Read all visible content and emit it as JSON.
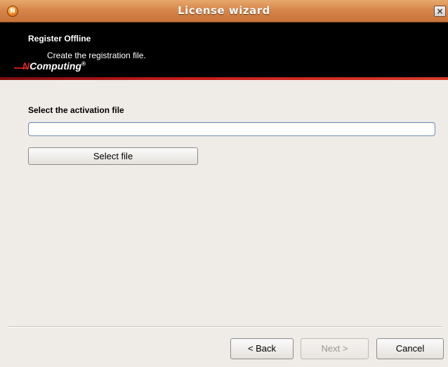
{
  "window": {
    "title": "License wizard",
    "close_glyph": "×",
    "icon": "ncomputing-app-icon",
    "icon_glyph": "N"
  },
  "banner": {
    "title": "Register Offline",
    "subtitle": "Create the registration file.",
    "logo_letter": "N",
    "logo_word": "Computing",
    "logo_mark": "®"
  },
  "form": {
    "label": "Select the activation file",
    "file_path_value": "",
    "file_path_placeholder": "",
    "select_button_label": "Select file"
  },
  "footer": {
    "back_label": "< Back",
    "next_label": "Next >",
    "cancel_label": "Cancel",
    "next_enabled": false
  },
  "colors": {
    "titlebar": "#d7864a",
    "banner_bg": "#000000",
    "banner_stripe": "#c41a1a",
    "window_bg": "#efebe7",
    "input_border": "#6f8fb5"
  }
}
